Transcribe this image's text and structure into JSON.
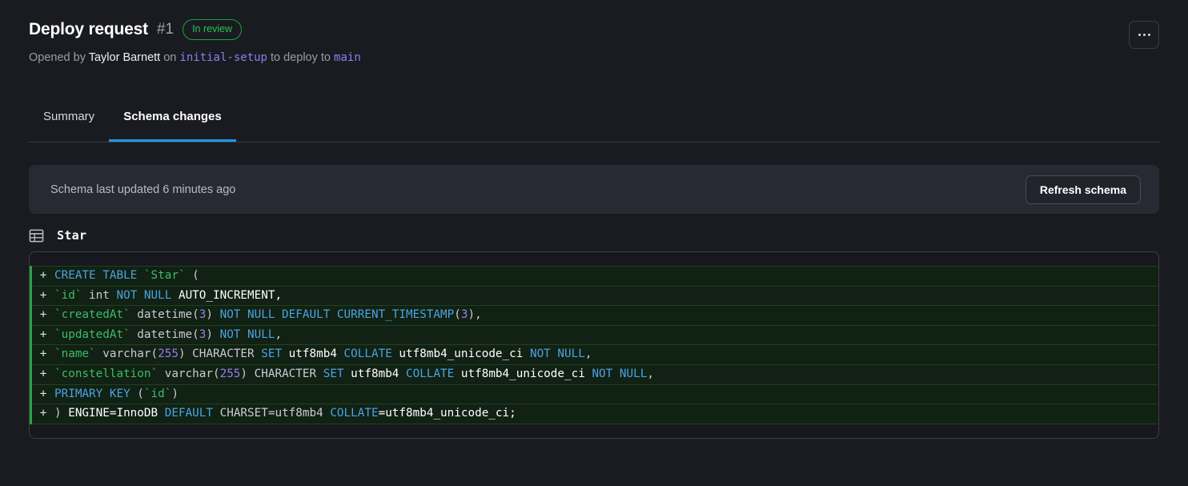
{
  "header": {
    "title": "Deploy request",
    "number": "#1",
    "status": "In review",
    "status_color": "#23c552",
    "opened_by_prefix": "Opened by",
    "author": "Taylor Barnett",
    "on_word": "on",
    "source_branch": "initial-setup",
    "deploy_to_words": "to deploy to",
    "target_branch": "main",
    "branch_color": "#8b7ef0",
    "more_menu_icon": "ellipsis-icon"
  },
  "tabs": [
    {
      "label": "Summary",
      "active": false
    },
    {
      "label": "Schema changes",
      "active": true
    }
  ],
  "tabs_accent_color": "#2196e8",
  "schema_bar": {
    "status_text": "Schema last updated 6 minutes ago",
    "refresh_label": "Refresh schema"
  },
  "table": {
    "icon": "table-icon",
    "name": "Star"
  },
  "diff": {
    "marker": "+",
    "lines": [
      [
        {
          "t": "CREATE TABLE ",
          "c": "k"
        },
        {
          "t": "`Star`",
          "c": "id"
        },
        {
          "t": " (",
          "c": "p"
        }
      ],
      [
        {
          "t": "`id`",
          "c": "id"
        },
        {
          "t": " int ",
          "c": "p"
        },
        {
          "t": "NOT NULL",
          "c": "k"
        },
        {
          "t": " AUTO_INCREMENT,",
          "c": "w"
        }
      ],
      [
        {
          "t": "`createdAt`",
          "c": "id"
        },
        {
          "t": " datetime(",
          "c": "p"
        },
        {
          "t": "3",
          "c": "n"
        },
        {
          "t": ") ",
          "c": "p"
        },
        {
          "t": "NOT NULL DEFAULT CURRENT_TIMESTAMP",
          "c": "k"
        },
        {
          "t": "(",
          "c": "p"
        },
        {
          "t": "3",
          "c": "n"
        },
        {
          "t": "),",
          "c": "p"
        }
      ],
      [
        {
          "t": "`updatedAt`",
          "c": "id"
        },
        {
          "t": " datetime(",
          "c": "p"
        },
        {
          "t": "3",
          "c": "n"
        },
        {
          "t": ") ",
          "c": "p"
        },
        {
          "t": "NOT NULL",
          "c": "k"
        },
        {
          "t": ",",
          "c": "p"
        }
      ],
      [
        {
          "t": "`name`",
          "c": "id"
        },
        {
          "t": " varchar(",
          "c": "p"
        },
        {
          "t": "255",
          "c": "n"
        },
        {
          "t": ") CHARACTER ",
          "c": "p"
        },
        {
          "t": "SET",
          "c": "k"
        },
        {
          "t": " utf8mb4 ",
          "c": "w"
        },
        {
          "t": "COLLATE",
          "c": "k"
        },
        {
          "t": " utf8mb4_unicode_ci ",
          "c": "w"
        },
        {
          "t": "NOT NULL",
          "c": "k"
        },
        {
          "t": ",",
          "c": "p"
        }
      ],
      [
        {
          "t": "`constellation`",
          "c": "id"
        },
        {
          "t": " varchar(",
          "c": "p"
        },
        {
          "t": "255",
          "c": "n"
        },
        {
          "t": ") CHARACTER ",
          "c": "p"
        },
        {
          "t": "SET",
          "c": "k"
        },
        {
          "t": " utf8mb4 ",
          "c": "w"
        },
        {
          "t": "COLLATE",
          "c": "k"
        },
        {
          "t": " utf8mb4_unicode_ci ",
          "c": "w"
        },
        {
          "t": "NOT NULL",
          "c": "k"
        },
        {
          "t": ",",
          "c": "p"
        }
      ],
      [
        {
          "t": "PRIMARY KEY",
          "c": "k"
        },
        {
          "t": " (",
          "c": "p"
        },
        {
          "t": "`id`",
          "c": "id"
        },
        {
          "t": ")",
          "c": "p"
        }
      ],
      [
        {
          "t": ") ",
          "c": "p"
        },
        {
          "t": "ENGINE=InnoDB ",
          "c": "w"
        },
        {
          "t": "DEFAULT",
          "c": "k"
        },
        {
          "t": " CHARSET=utf8mb4 ",
          "c": "p"
        },
        {
          "t": "COLLATE",
          "c": "k"
        },
        {
          "t": "=utf8mb4_unicode_ci;",
          "c": "w"
        }
      ]
    ]
  }
}
